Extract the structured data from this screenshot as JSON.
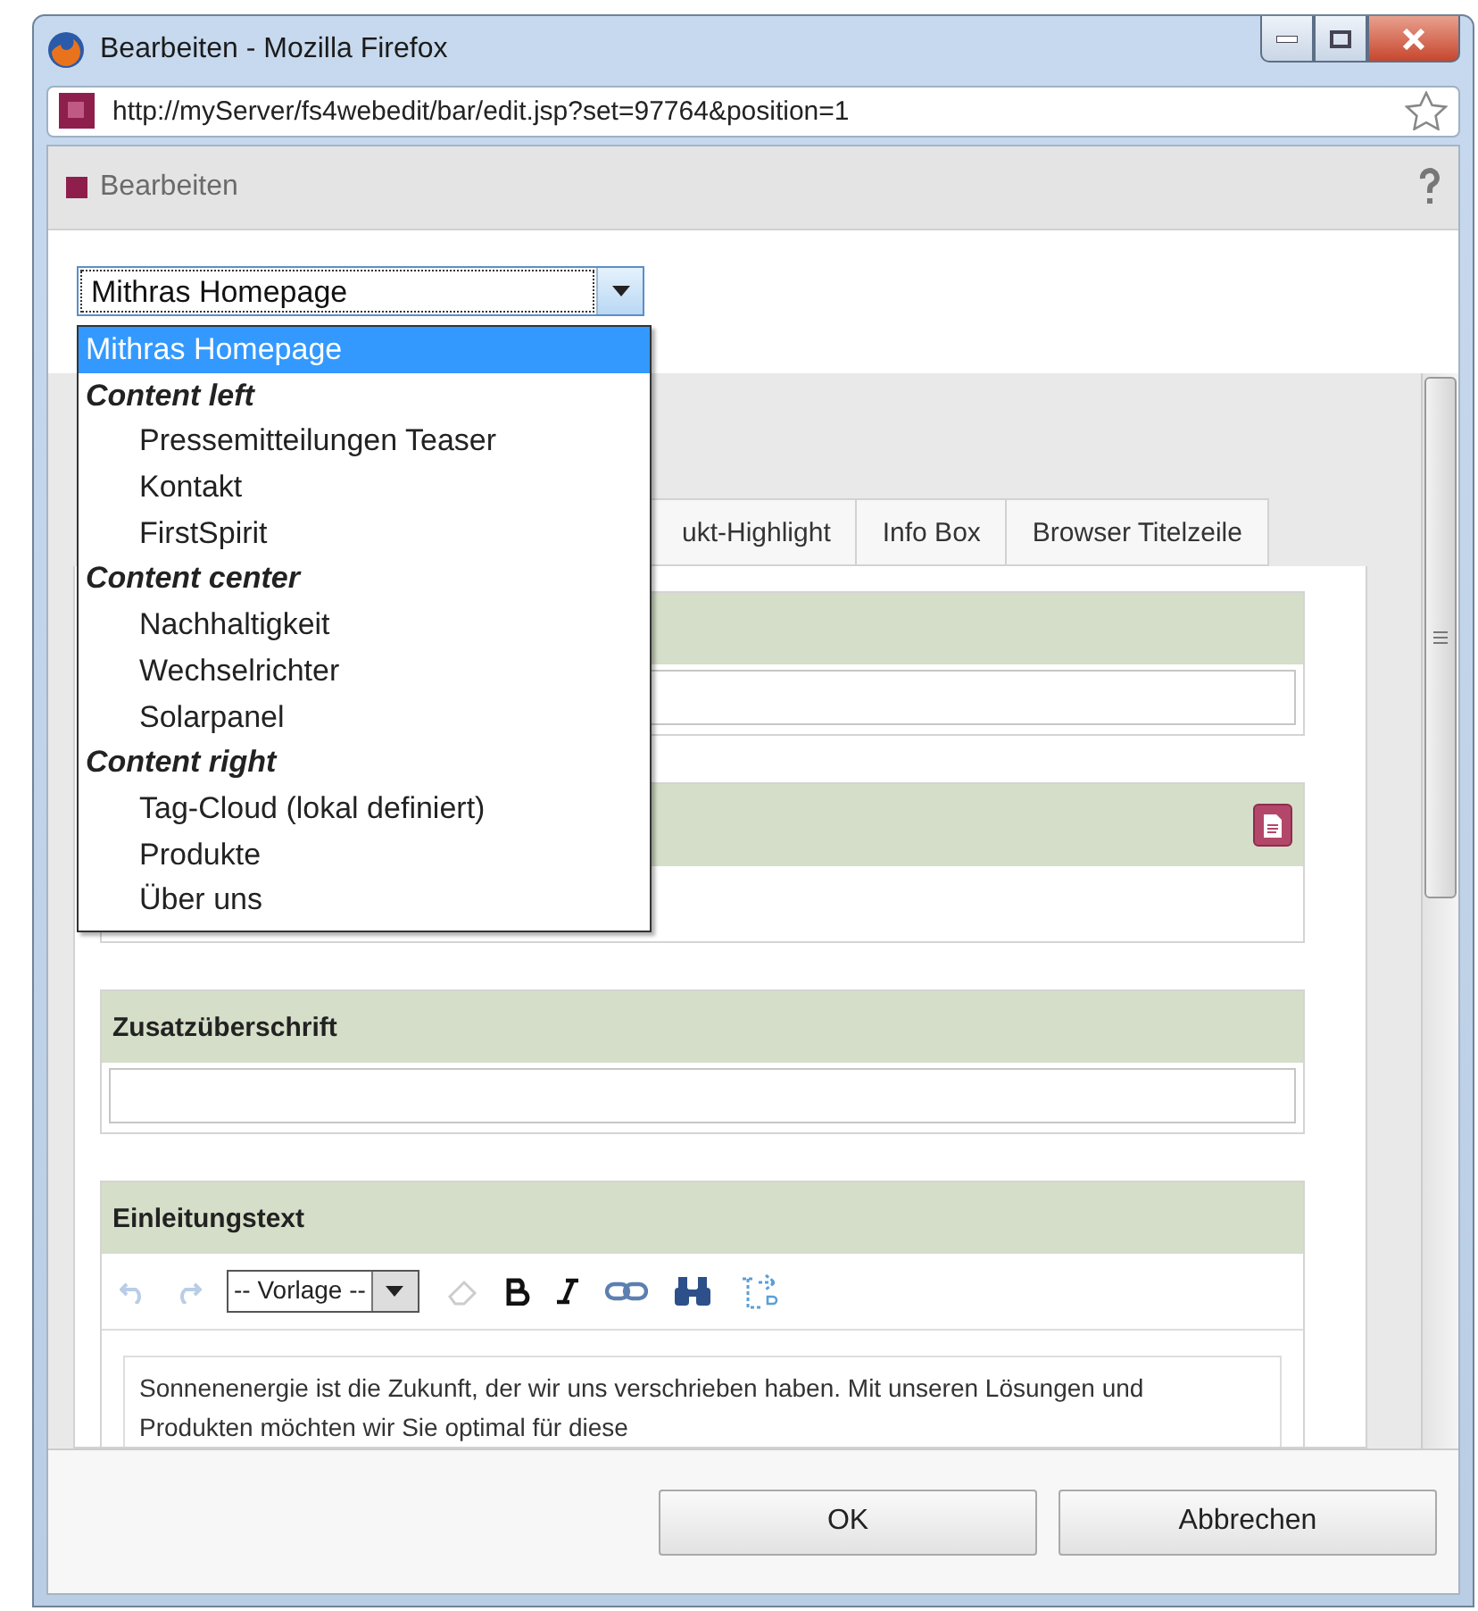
{
  "window": {
    "title": "Bearbeiten - Mozilla Firefox"
  },
  "address_bar": {
    "url": "http://myServer/fs4webedit/bar/edit.jsp?set=97764&position=1"
  },
  "dialog_header": {
    "title": "Bearbeiten"
  },
  "page_select": {
    "value": "Mithras Homepage",
    "expanded": true,
    "options": [
      {
        "kind": "page",
        "label": "Mithras Homepage",
        "selected": true
      },
      {
        "kind": "group",
        "label": "Content left"
      },
      {
        "kind": "page",
        "label": "Pressemitteilungen Teaser",
        "selected": false
      },
      {
        "kind": "page",
        "label": "Kontakt",
        "selected": false
      },
      {
        "kind": "page",
        "label": "FirstSpirit",
        "selected": false
      },
      {
        "kind": "group",
        "label": "Content center"
      },
      {
        "kind": "page",
        "label": "Nachhaltigkeit",
        "selected": false
      },
      {
        "kind": "page",
        "label": "Wechselrichter",
        "selected": false
      },
      {
        "kind": "page",
        "label": "Solarpanel",
        "selected": false
      },
      {
        "kind": "group",
        "label": "Content right"
      },
      {
        "kind": "page",
        "label": "Tag-Cloud (lokal definiert)",
        "selected": false
      },
      {
        "kind": "page",
        "label": "Produkte",
        "selected": false
      },
      {
        "kind": "page",
        "label": "Über uns",
        "selected": false
      }
    ]
  },
  "tabs": [
    {
      "label": "ukt-Highlight",
      "selected": false
    },
    {
      "label": "Info Box",
      "selected": false
    },
    {
      "label": "Browser Titelzeile",
      "selected": false
    }
  ],
  "sections": [
    {
      "kind": "input"
    },
    {
      "kind": "area",
      "has_document_button": true
    },
    {
      "kind": "input",
      "label": "Zusatzüberschrift"
    },
    {
      "kind": "richtext",
      "label": "Einleitungstext",
      "template": "-- Vorlage --",
      "text": "Sonnenenergie ist die Zukunft, der wir uns verschrieben haben. Mit unseren Lösungen und Produkten möchten wir Sie optimal für diese"
    }
  ],
  "buttons": [
    {
      "label": "OK"
    },
    {
      "label": "Abbrechen"
    }
  ]
}
